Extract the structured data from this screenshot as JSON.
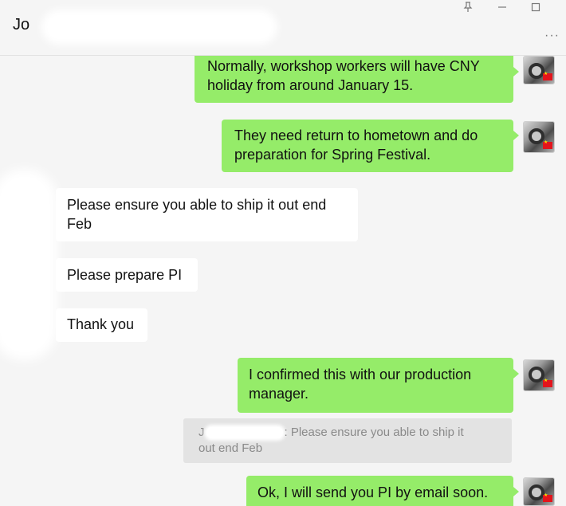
{
  "header": {
    "chat_name": "Jo",
    "pin_icon": "pin-icon",
    "minimize_icon": "minimize-icon",
    "maximize_icon": "maximize-icon",
    "more_icon": "more-options-icon"
  },
  "messages": [
    {
      "side": "out",
      "lines": [
        "Normally, workshop workers will have CNY",
        "holiday from around January 15."
      ]
    },
    {
      "side": "out",
      "lines": [
        "They need return to hometown and do",
        "preparation for Spring Festival."
      ]
    },
    {
      "side": "in",
      "lines": [
        "Please ensure you able to ship it out end",
        "Feb"
      ]
    },
    {
      "side": "in",
      "lines": [
        "Please prepare PI"
      ]
    },
    {
      "side": "in",
      "lines": [
        "Thank you"
      ]
    },
    {
      "side": "out",
      "lines": [
        "I confirmed this with our production",
        "manager."
      ]
    },
    {
      "side": "out",
      "lines": [
        "Ok, I will send you PI by email soon."
      ]
    }
  ],
  "quote": {
    "sender_prefix": "J",
    "text_line1": ": Please ensure you able to ship it",
    "text_line2": "out end Feb"
  },
  "colors": {
    "outgoing_bubble": "#95ec69",
    "incoming_bubble": "#ffffff",
    "background": "#f5f5f5"
  }
}
